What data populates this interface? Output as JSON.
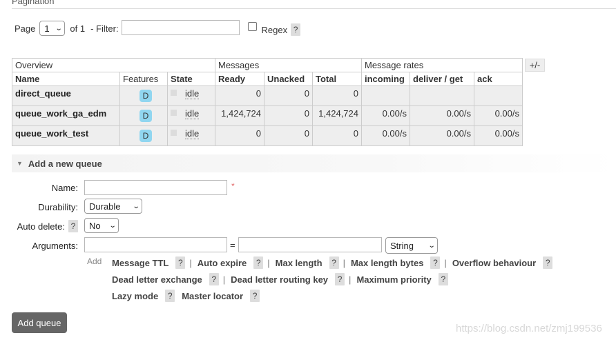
{
  "pagination": {
    "heading": "Pagination",
    "page_label": "Page",
    "page_value": "1",
    "of_label": "of 1",
    "filter_label": "- Filter:",
    "filter_value": "",
    "regex_label": "Regex",
    "regex_checked": false,
    "help_label": "?"
  },
  "table": {
    "groups": [
      "Overview",
      "Messages",
      "Message rates"
    ],
    "columns": [
      "Name",
      "Features",
      "State",
      "Ready",
      "Unacked",
      "Total",
      "incoming",
      "deliver / get",
      "ack"
    ],
    "toggle_label": "+/-",
    "rows": [
      {
        "name": "direct_queue",
        "feature": "D",
        "state": "idle",
        "ready": "0",
        "unacked": "0",
        "total": "0",
        "incoming": "",
        "deliver_get": "",
        "ack": ""
      },
      {
        "name": "queue_work_ga_edm",
        "feature": "D",
        "state": "idle",
        "ready": "1,424,724",
        "unacked": "0",
        "total": "1,424,724",
        "incoming": "0.00/s",
        "deliver_get": "0.00/s",
        "ack": "0.00/s"
      },
      {
        "name": "queue_work_test",
        "feature": "D",
        "state": "idle",
        "ready": "0",
        "unacked": "0",
        "total": "0",
        "incoming": "0.00/s",
        "deliver_get": "0.00/s",
        "ack": "0.00/s"
      }
    ]
  },
  "add_queue": {
    "section_title": "Add a new queue",
    "name_label": "Name:",
    "name_value": "",
    "required_mark": "*",
    "durability_label": "Durability:",
    "durability_value": "Durable",
    "auto_delete_label": "Auto delete:",
    "auto_delete_value": "No",
    "help_label": "?",
    "arguments_label": "Arguments:",
    "arg_key": "",
    "equals": "=",
    "arg_value": "",
    "arg_type": "String",
    "add_label": "Add",
    "arg_options": [
      [
        "Message TTL",
        "Auto expire",
        "Max length",
        "Max length bytes",
        "Overflow behaviour"
      ],
      [
        "Dead letter exchange",
        "Dead letter routing key",
        "Maximum priority"
      ],
      [
        "Lazy mode",
        "Master locator"
      ]
    ],
    "separator": "|",
    "submit_label": "Add queue"
  },
  "watermark": "https://blog.csdn.net/zmj199536",
  "colors": {
    "feature_badge": "#90d6f0",
    "row_background": "#eeeeee",
    "button_background": "#666666",
    "required": "#e26a6a"
  }
}
